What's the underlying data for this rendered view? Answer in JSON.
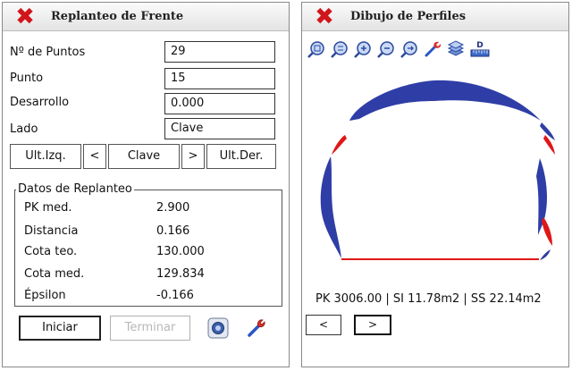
{
  "left": {
    "title": "Replanteo de Frente",
    "fields": [
      {
        "label": "Nº de Puntos",
        "value": "29"
      },
      {
        "label": "Punto",
        "value": "15"
      },
      {
        "label": "Desarrollo",
        "value": "0.000"
      },
      {
        "label": "Lado",
        "value": "Clave"
      }
    ],
    "nav": {
      "ult_izq": "Ult.Izq.",
      "prev": "<",
      "current": "Clave",
      "next": ">",
      "ult_der": "Ult.Der."
    },
    "group": {
      "title": "Datos de Replanteo",
      "rows": [
        {
          "label": "PK med.",
          "value": "2.900"
        },
        {
          "label": "Distancia",
          "value": "0.166"
        },
        {
          "label": "Cota teo.",
          "value": "130.000"
        },
        {
          "label": "Cota med.",
          "value": "129.834"
        },
        {
          "label": "Épsilon",
          "value": "-0.166"
        }
      ]
    },
    "buttons": {
      "iniciar": "Iniciar",
      "terminar": "Terminar"
    }
  },
  "right": {
    "title": "Dibujo de Perfiles",
    "toolbar_icons": [
      "zoom-all-icon",
      "zoom-window-icon",
      "zoom-in-icon",
      "zoom-out-icon",
      "zoom-next-icon",
      "tools-wrench-icon",
      "layers-icon",
      "distance-ruler-icon"
    ],
    "ruler_glyph": "D",
    "status": "PK 3006.00 | SI 11.78m2 | SS 22.14m2",
    "prev": "<",
    "next": ">"
  },
  "colors": {
    "close": "#d0161b",
    "profile_blue": "#2f3ea6",
    "profile_red": "#e01717"
  }
}
